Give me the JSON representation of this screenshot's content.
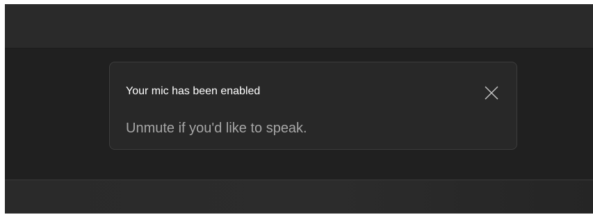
{
  "notification": {
    "title": "Your mic has been enabled",
    "message": "Unmute if you'd like to speak.",
    "close_icon": "close-icon"
  },
  "colors": {
    "background": "#202020",
    "top_bar": "#2a2a2a",
    "toast_background": "#282828",
    "toast_border": "#3d3d3d",
    "title_text": "#ffffff",
    "message_text": "#a6a6a6",
    "close_icon": "#c8c8c8"
  }
}
